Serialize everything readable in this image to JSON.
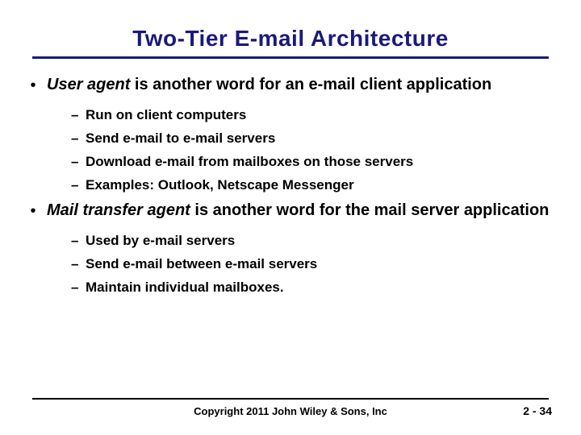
{
  "title": "Two-Tier E-mail Architecture",
  "bullets": [
    {
      "lead": "User agent",
      "rest": " is another word for an e-mail client application",
      "subs": [
        "Run on client computers",
        "Send e-mail to e-mail servers",
        "Download e-mail from mailboxes on those servers",
        "Examples: Outlook, Netscape Messenger"
      ]
    },
    {
      "lead": "Mail transfer agent",
      "rest": " is another word for the mail server application",
      "subs": [
        "Used by e-mail servers",
        "Send e-mail between e-mail servers",
        "Maintain individual mailboxes."
      ]
    }
  ],
  "footer": {
    "copyright": "Copyright 2011 John Wiley & Sons, Inc",
    "page": "2 - 34"
  }
}
